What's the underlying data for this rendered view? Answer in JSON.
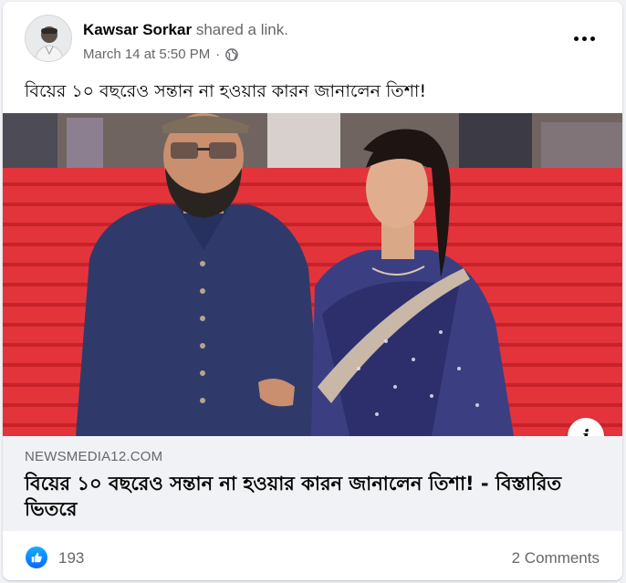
{
  "post": {
    "author_name": "Kawsar Sorkar",
    "action_text": "shared a link.",
    "timestamp": "March 14 at 5:50 PM",
    "separator": "·",
    "audience_icon": "globe-icon",
    "text": "বিয়ের ১০ বছরেও সন্তান না হওয়ার কারন জানালেন তিশা!"
  },
  "link_preview": {
    "domain": "NEWSMEDIA12.COM",
    "title": "বিয়ের ১০ বছরেও সন্তান না হওয়ার কারন জানালেন তিশা! - বিস্তারিত ভিতরে",
    "info_label": "i"
  },
  "reactions": {
    "like_icon": "thumbs-up-icon",
    "count": "193",
    "comments": "2 Comments"
  },
  "colors": {
    "accent": "#0866ff",
    "secondary_text": "#65676b",
    "card_background": "#ffffff",
    "page_background": "#f0f2f5"
  }
}
